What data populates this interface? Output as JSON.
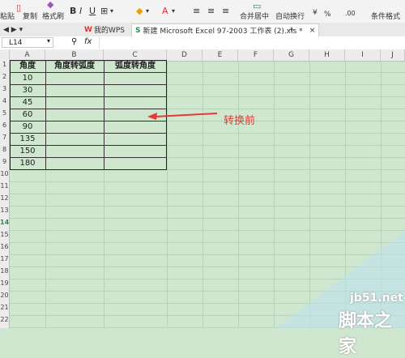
{
  "ribbon": {
    "paste_label": "粘贴",
    "copy_label": "复制",
    "format_painter_label": "格式刷",
    "merge_center_label": "合并居中",
    "wrap_text_label": "自动换行",
    "percent_label": "%",
    "conditional_format_label": "条件格式"
  },
  "tabs": [
    {
      "label": "我的WPS"
    },
    {
      "label": "新建 Microsoft Excel 97-2003 工作表 (2).xls *"
    }
  ],
  "formula_bar": {
    "cell_ref": "L14",
    "fx_label": "fx"
  },
  "columns": [
    "A",
    "B",
    "C",
    "D",
    "E",
    "F",
    "G",
    "H",
    "I",
    "J"
  ],
  "rows": [
    "1",
    "2",
    "3",
    "4",
    "5",
    "6",
    "7",
    "8",
    "9",
    "10",
    "11",
    "12",
    "13",
    "14",
    "15",
    "16",
    "17",
    "18",
    "19",
    "20",
    "21",
    "22"
  ],
  "table": {
    "headers": [
      "角度",
      "角度转弧度",
      "弧度转角度"
    ],
    "values": [
      "10",
      "30",
      "45",
      "60",
      "90",
      "135",
      "150",
      "180"
    ]
  },
  "annotation": {
    "label": "转换前",
    "color": "#e53935"
  },
  "watermark": {
    "site": "jb51.net",
    "name": "脚本之家"
  }
}
